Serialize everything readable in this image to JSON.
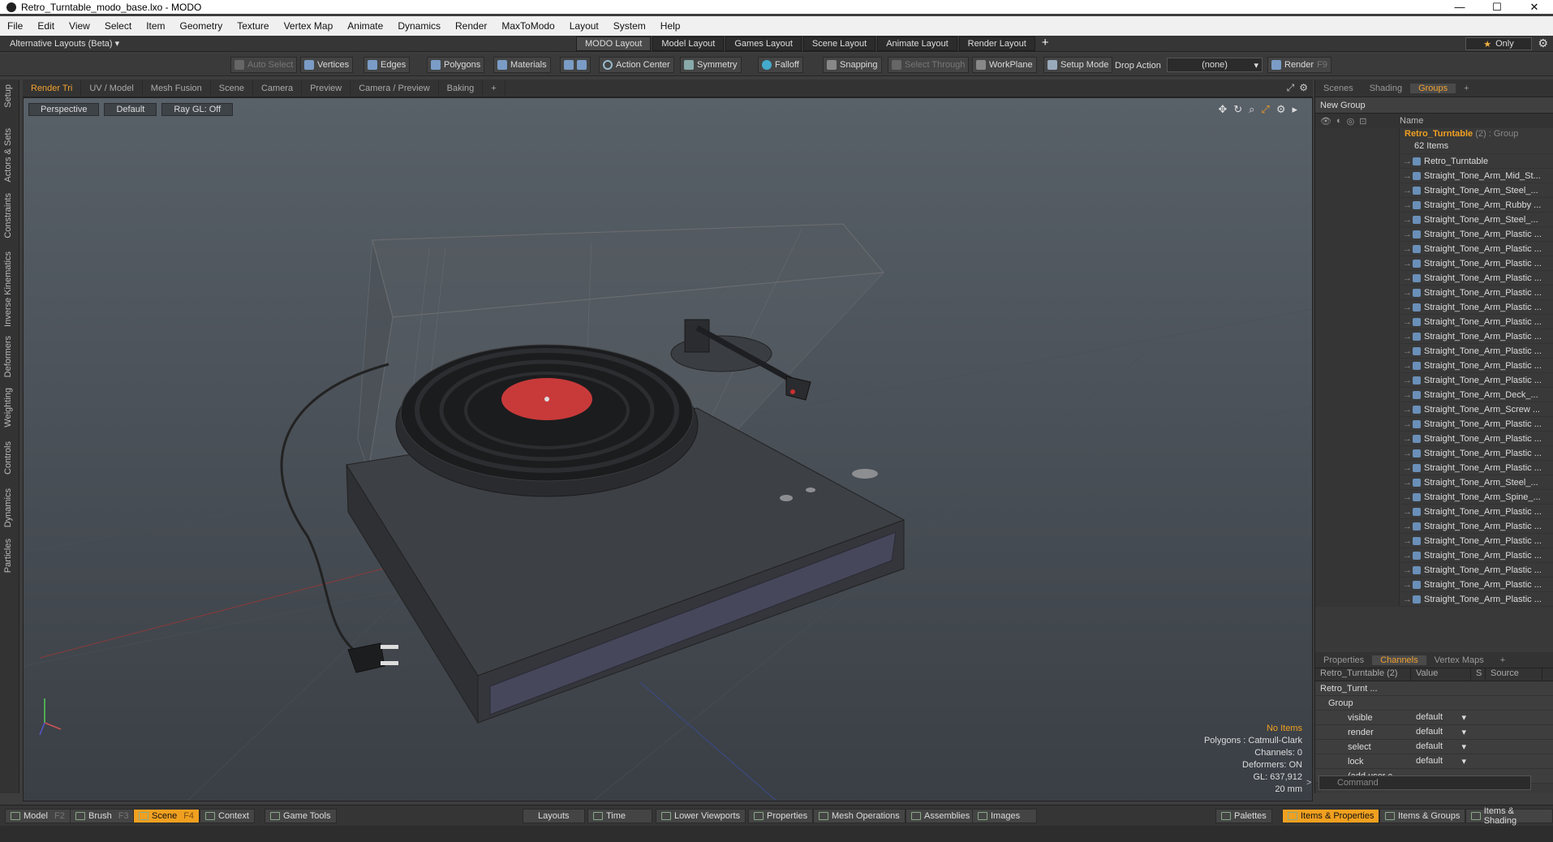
{
  "window": {
    "title": "Retro_Turntable_modo_base.lxo - MODO",
    "minimize": "—",
    "maximize": "☐",
    "close": "✕"
  },
  "menu": [
    "File",
    "Edit",
    "View",
    "Select",
    "Item",
    "Geometry",
    "Texture",
    "Vertex Map",
    "Animate",
    "Dynamics",
    "Render",
    "MaxToModo",
    "Layout",
    "System",
    "Help"
  ],
  "layouts": {
    "selector": "Alternative Layouts (Beta) ▾",
    "tabs": [
      "MODO Layout",
      "Model Layout",
      "Games Layout",
      "Scene Layout",
      "Animate Layout",
      "Render Layout"
    ],
    "add": "+",
    "only": "Only"
  },
  "toolbar": {
    "auto_select": "Auto Select",
    "vertices": "Vertices",
    "edges": "Edges",
    "polygons": "Polygons",
    "materials": "Materials",
    "action_center": "Action Center",
    "symmetry": "Symmetry",
    "falloff": "Falloff",
    "snapping": "Snapping",
    "select_through": "Select Through",
    "workplane": "WorkPlane",
    "setup_mode": "Setup Mode",
    "drop_action": "Drop Action",
    "drop_value": "(none)",
    "render": "Render",
    "render_key": "F9"
  },
  "left_tabs": [
    "Setup",
    "Actors & Sets",
    "Constraints",
    "Inverse Kinematics",
    "Deformers",
    "Weighting",
    "Controls",
    "Dynamics",
    "Particles"
  ],
  "viewport_tabs": [
    "Render Tri",
    "UV / Model",
    "Mesh Fusion",
    "Scene",
    "Camera",
    "Preview",
    "Camera / Preview",
    "Baking",
    "+"
  ],
  "viewport": {
    "view": "Perspective",
    "shading": "Default",
    "raygl": "Ray GL: Off",
    "info": {
      "items": "No Items",
      "polygons": "Polygons : Catmull-Clark",
      "channels": "Channels: 0",
      "deformers": "Deformers: ON",
      "gl": "GL: 637,912",
      "scale": "20 mm"
    }
  },
  "right": {
    "tabs": [
      "Scenes",
      "Shading",
      "Groups",
      "+"
    ],
    "new_group": "New Group",
    "name_col": "Name",
    "group": {
      "name": "Retro_Turntable",
      "suffix": "(2) : Group",
      "count": "62 Items"
    },
    "items": [
      "Retro_Turntable",
      "Straight_Tone_Arm_Mid_St...",
      "Straight_Tone_Arm_Steel_...",
      "Straight_Tone_Arm_Rubby ...",
      "Straight_Tone_Arm_Steel_...",
      "Straight_Tone_Arm_Plastic ...",
      "Straight_Tone_Arm_Plastic ...",
      "Straight_Tone_Arm_Plastic ...",
      "Straight_Tone_Arm_Plastic ...",
      "Straight_Tone_Arm_Plastic ...",
      "Straight_Tone_Arm_Plastic ...",
      "Straight_Tone_Arm_Plastic ...",
      "Straight_Tone_Arm_Plastic ...",
      "Straight_Tone_Arm_Plastic ...",
      "Straight_Tone_Arm_Plastic ...",
      "Straight_Tone_Arm_Plastic ...",
      "Straight_Tone_Arm_Deck_...",
      "Straight_Tone_Arm_Screw ...",
      "Straight_Tone_Arm_Plastic ...",
      "Straight_Tone_Arm_Plastic ...",
      "Straight_Tone_Arm_Plastic ...",
      "Straight_Tone_Arm_Plastic ...",
      "Straight_Tone_Arm_Steel_...",
      "Straight_Tone_Arm_Spine_...",
      "Straight_Tone_Arm_Plastic ...",
      "Straight_Tone_Arm_Plastic ...",
      "Straight_Tone_Arm_Plastic ...",
      "Straight_Tone_Arm_Plastic ...",
      "Straight_Tone_Arm_Plastic ...",
      "Straight_Tone_Arm_Plastic ...",
      "Straight_Tone_Arm_Plastic ..."
    ],
    "ch_tabs": [
      "Properties",
      "Channels",
      "Vertex Maps",
      "+"
    ],
    "ch_header": [
      "Retro_Turntable (2)",
      "Value",
      "S",
      "Source"
    ],
    "ch_rows": [
      {
        "name": "Retro_Turnt ...",
        "value": ""
      },
      {
        "name": "Group",
        "value": ""
      },
      {
        "name": "visible",
        "value": "default"
      },
      {
        "name": "render",
        "value": "default"
      },
      {
        "name": "select",
        "value": "default"
      },
      {
        "name": "lock",
        "value": "default"
      },
      {
        "name": "(add user c...",
        "value": ""
      }
    ],
    "command": "Command"
  },
  "bottom": {
    "model": "Model",
    "model_key": "F2",
    "brush": "Brush",
    "brush_key": "F3",
    "scene": "Scene",
    "scene_key": "F4",
    "context": "Context",
    "game_tools": "Game Tools",
    "layouts": "Layouts",
    "time": "Time",
    "lower_viewports": "Lower Viewports",
    "properties": "Properties",
    "mesh_ops": "Mesh Operations",
    "assemblies": "Assemblies",
    "images": "Images",
    "palettes": "Palettes",
    "items_props": "Items & Properties",
    "items_groups": "Items & Groups",
    "items_shading": "Items & Shading"
  },
  "colors": {
    "accent": "#f0a020",
    "record_label": "#c83a3a",
    "viewport_top": "#586068",
    "viewport_bottom": "#3a3f45"
  }
}
